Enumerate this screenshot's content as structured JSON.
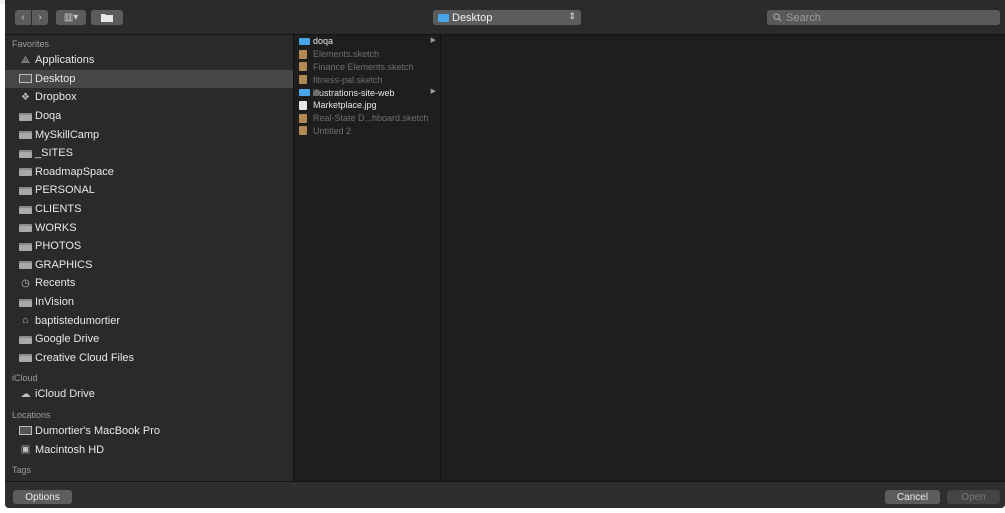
{
  "window": {
    "location": "Desktop",
    "search_placeholder": "Search"
  },
  "toolbar": {
    "back_glyph": "‹",
    "forward_glyph": "›",
    "view_glyph": "▥▾",
    "new_folder_icon": "folder-icon"
  },
  "sidebar": {
    "sections": {
      "favorites": "Favorites",
      "icloud": "iCloud",
      "locations": "Locations",
      "tags": "Tags"
    },
    "favorites": [
      {
        "label": "Applications",
        "icon": "applications-icon"
      },
      {
        "label": "Desktop",
        "icon": "desktop-icon",
        "selected": true
      },
      {
        "label": "Dropbox",
        "icon": "dropbox-icon"
      },
      {
        "label": "Doqa",
        "icon": "folder-icon"
      },
      {
        "label": "MySkillCamp",
        "icon": "folder-icon"
      },
      {
        "label": "_SITES",
        "icon": "folder-icon"
      },
      {
        "label": "RoadmapSpace",
        "icon": "folder-icon"
      },
      {
        "label": "PERSONAL",
        "icon": "folder-icon"
      },
      {
        "label": "CLIENTS",
        "icon": "folder-icon"
      },
      {
        "label": "WORKS",
        "icon": "folder-icon"
      },
      {
        "label": "PHOTOS",
        "icon": "folder-icon"
      },
      {
        "label": "GRAPHICS",
        "icon": "folder-icon"
      },
      {
        "label": "Recents",
        "icon": "recents-icon"
      },
      {
        "label": "InVision",
        "icon": "folder-icon"
      },
      {
        "label": "baptistedumortier",
        "icon": "home-icon"
      },
      {
        "label": "Google Drive",
        "icon": "folder-icon"
      },
      {
        "label": "Creative Cloud Files",
        "icon": "folder-icon"
      }
    ],
    "icloud": [
      {
        "label": "iCloud Drive",
        "icon": "cloud-icon"
      }
    ],
    "locations": [
      {
        "label": "Dumortier's MacBook Pro",
        "icon": "laptop-icon"
      },
      {
        "label": "Macintosh HD",
        "icon": "disk-icon"
      }
    ]
  },
  "files": [
    {
      "name": "doqa",
      "kind": "folder",
      "enabled": true,
      "has_children": true
    },
    {
      "name": "Elements.sketch",
      "kind": "sketch",
      "enabled": false
    },
    {
      "name": "Finance Elements.sketch",
      "kind": "sketch",
      "enabled": false
    },
    {
      "name": "fitness-pal.sketch",
      "kind": "sketch",
      "enabled": false
    },
    {
      "name": "illustrations-site-web",
      "kind": "folder",
      "enabled": true,
      "has_children": true
    },
    {
      "name": "Marketplace.jpg",
      "kind": "image",
      "enabled": true
    },
    {
      "name": "Real-State D...hboard.sketch",
      "kind": "sketch",
      "enabled": false
    },
    {
      "name": "Untitled 2",
      "kind": "sketch",
      "enabled": false
    }
  ],
  "footer": {
    "options_label": "Options",
    "cancel_label": "Cancel",
    "open_label": "Open"
  }
}
